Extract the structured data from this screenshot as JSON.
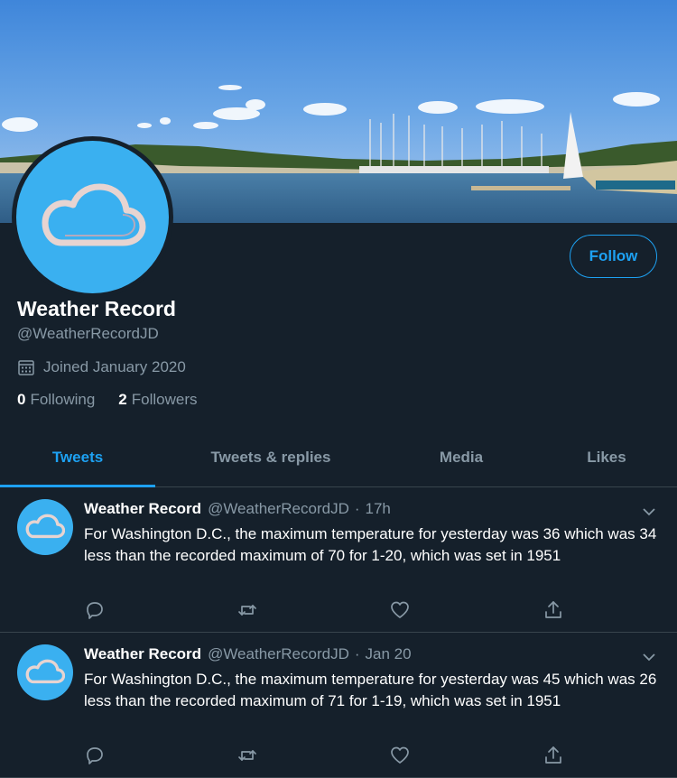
{
  "profile": {
    "name": "Weather Record",
    "handle": "@WeatherRecordJD",
    "joined": "Joined January 2020",
    "following_count": "0",
    "following_label": "Following",
    "followers_count": "2",
    "followers_label": "Followers",
    "follow_button": "Follow"
  },
  "tabs": [
    {
      "label": "Tweets",
      "active": true
    },
    {
      "label": "Tweets & replies",
      "active": false
    },
    {
      "label": "Media",
      "active": false
    },
    {
      "label": "Likes",
      "active": false
    }
  ],
  "tweets": [
    {
      "name": "Weather Record",
      "handle": "@WeatherRecordJD",
      "sep": "·",
      "time": "17h",
      "text": "For Washington D.C., the maximum temperature for yesterday was 36 which was 34 less than the recorded maximum of 70 for 1-20, which was set in 1951"
    },
    {
      "name": "Weather Record",
      "handle": "@WeatherRecordJD",
      "sep": "·",
      "time": "Jan 20",
      "text": "For Washington D.C., the maximum temperature for yesterday was 45 which was 26 less than the recorded maximum of 71 for 1-19, which was set in 1951"
    }
  ],
  "colors": {
    "background": "#15202b",
    "accent": "#1da1f2",
    "muted_text": "#8899a6",
    "avatar_blue": "#3ab0f0",
    "divider": "#38444d"
  },
  "icons": {
    "avatar": "cloud-icon",
    "joined": "calendar-icon",
    "reply": "reply-icon",
    "retweet": "retweet-icon",
    "like": "heart-icon",
    "share": "share-icon",
    "menu": "chevron-down-icon"
  }
}
